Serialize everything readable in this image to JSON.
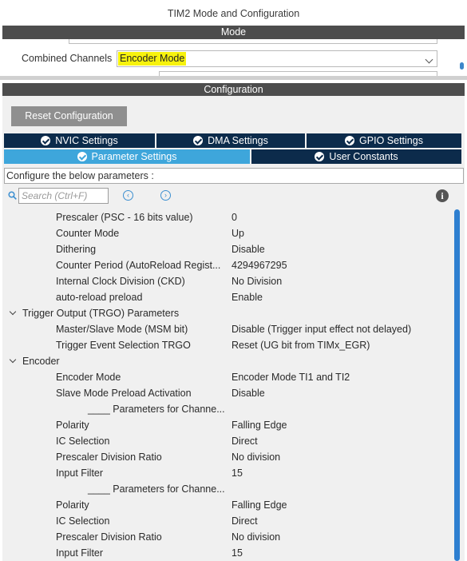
{
  "window": {
    "title": "TIM2 Mode and Configuration"
  },
  "mode_section": {
    "header": "Mode",
    "combined_channels": {
      "label": "Combined Channels",
      "value": "Encoder Mode"
    }
  },
  "config_section": {
    "header": "Configuration",
    "reset_button": "Reset Configuration",
    "tabs_row1": [
      "NVIC Settings",
      "DMA Settings",
      "GPIO Settings"
    ],
    "tabs_row2": [
      "Parameter Settings",
      "User Constants"
    ],
    "active_tab": "Parameter Settings",
    "hint": "Configure the below parameters :",
    "search": {
      "placeholder": "Search (Ctrl+F)"
    },
    "nav_prev": "‹",
    "nav_next": "›",
    "info": "i"
  },
  "parameters": [
    {
      "kind": "param",
      "name": "Prescaler (PSC - 16 bits value)",
      "value": "0"
    },
    {
      "kind": "param",
      "name": "Counter Mode",
      "value": "Up"
    },
    {
      "kind": "param",
      "name": "Dithering",
      "value": "Disable"
    },
    {
      "kind": "param",
      "name": "Counter Period (AutoReload Regist...",
      "value": "4294967295"
    },
    {
      "kind": "param",
      "name": "Internal Clock Division (CKD)",
      "value": "No Division"
    },
    {
      "kind": "param",
      "name": "auto-reload preload",
      "value": "Enable"
    },
    {
      "kind": "group",
      "name": "Trigger Output (TRGO) Parameters",
      "value": ""
    },
    {
      "kind": "param",
      "name": "Master/Slave Mode (MSM bit)",
      "value": "Disable (Trigger input effect not delayed)"
    },
    {
      "kind": "param",
      "name": "Trigger Event Selection TRGO",
      "value": "Reset (UG bit from TIMx_EGR)"
    },
    {
      "kind": "group",
      "name": "Encoder",
      "value": ""
    },
    {
      "kind": "param",
      "name": "Encoder Mode",
      "value": "Encoder Mode TI1 and TI2"
    },
    {
      "kind": "param",
      "name": "Slave Mode Preload Activation",
      "value": "Disable"
    },
    {
      "kind": "sub",
      "name": "____ Parameters for Channe...",
      "value": ""
    },
    {
      "kind": "param",
      "name": "Polarity",
      "value": "Falling Edge"
    },
    {
      "kind": "param",
      "name": "IC Selection",
      "value": "Direct"
    },
    {
      "kind": "param",
      "name": "Prescaler Division Ratio",
      "value": "No division"
    },
    {
      "kind": "param",
      "name": "Input Filter",
      "value": "15"
    },
    {
      "kind": "sub",
      "name": "____ Parameters for Channe...",
      "value": ""
    },
    {
      "kind": "param",
      "name": "Polarity",
      "value": "Falling Edge"
    },
    {
      "kind": "param",
      "name": "IC Selection",
      "value": "Direct"
    },
    {
      "kind": "param",
      "name": "Prescaler Division Ratio",
      "value": "No division"
    },
    {
      "kind": "param",
      "name": "Input Filter",
      "value": "15"
    }
  ]
}
